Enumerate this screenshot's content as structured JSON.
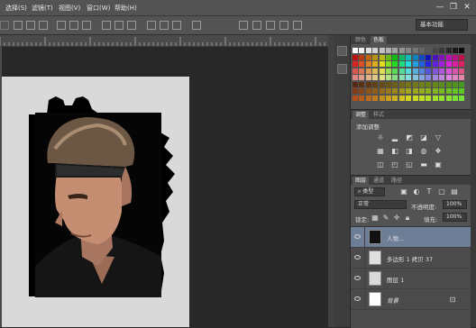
{
  "menu": {
    "items": [
      "选择(S)",
      "滤镜(T)",
      "视图(V)",
      "窗口(W)",
      "帮助(H)"
    ]
  },
  "window_controls": {
    "minimize": "—",
    "restore": "❐",
    "close": "✕"
  },
  "optionsbar": {
    "workspace": "基本功能"
  },
  "panels": {
    "swatches": {
      "tabs": [
        "颜色",
        "色板"
      ],
      "active_tab": "色板"
    },
    "adjustments": {
      "tabs": [
        "调整",
        "样式"
      ],
      "active_tab": "调整",
      "heading": "添加调整"
    },
    "layers": {
      "tabs": [
        "图层",
        "通道",
        "路径"
      ],
      "active_tab": "图层",
      "filter_kind": "类型",
      "blend_mode": "正常",
      "opacity_label": "不透明度:",
      "opacity_value": "100%",
      "lock_label": "锁定:",
      "fill_label": "填充:",
      "fill_value": "100%",
      "rows": [
        {
          "name": "人物...",
          "selected": true
        },
        {
          "name": "多边形 1 拷贝 37",
          "selected": false
        },
        {
          "name": "图层 1",
          "selected": false
        },
        {
          "name": "背景",
          "selected": false,
          "locked": true
        }
      ]
    }
  },
  "colors": {
    "accent_selected_layer": "#6e7e97",
    "document_background": "#d9d9d9",
    "shape_fill": "#000000"
  },
  "icons": {
    "move": "move-tool-icon",
    "eye": "eye-icon",
    "lock": "lock-icon",
    "link": "link-icon"
  }
}
